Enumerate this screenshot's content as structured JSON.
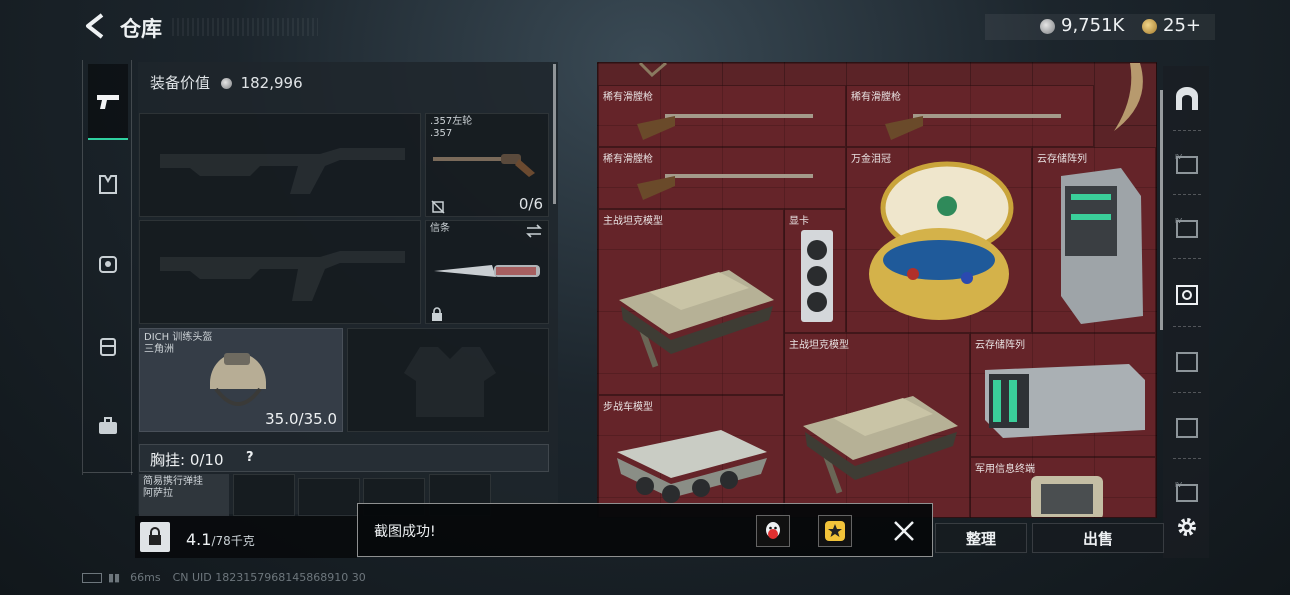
{
  "header": {
    "title": "仓库",
    "silver_amount": "9,751K",
    "gold_amount": "25+"
  },
  "left_tabs": [
    {
      "name": "weapon",
      "active": true
    },
    {
      "name": "armor",
      "active": false
    },
    {
      "name": "backpack",
      "active": false
    },
    {
      "name": "medkit",
      "active": false
    },
    {
      "name": "briefcase",
      "active": false
    }
  ],
  "equipment": {
    "value_label": "装备价值",
    "value_amount": "182,996",
    "revolver_label_line1": ".357左轮",
    "revolver_label_line2": ".357",
    "revolver_ammo": "0/6",
    "knife_label": "信条",
    "helmet_label_line1": "DICH 训练头盔",
    "helmet_label_line2": "三角洲",
    "helmet_durability": "35.0/35.0",
    "chest_label": "胸挂: 0/10",
    "chest_help": "?",
    "rig_label_line1": "简易携行弹挂",
    "rig_label_line2": "阿萨拉",
    "weight_current": "4.1",
    "weight_max": "/78千克"
  },
  "stash_items": [
    "稀有滑膛枪",
    "稀有滑膛枪",
    "稀有滑膛枪",
    "万金泪冠",
    "云存储阵列",
    "主战坦克模型",
    "显卡",
    "主战坦克模型",
    "云存储阵列",
    "步战车模型",
    "军用信息终端"
  ],
  "buttons": {
    "sort": "整理",
    "sell": "出售"
  },
  "toast": {
    "message": "截图成功!"
  },
  "status": {
    "ping": "66ms",
    "uid": "CN UID 1823157968145868910 30"
  },
  "colors": {
    "accent": "#2fd0a0",
    "stash_bg": "#5b2327"
  }
}
